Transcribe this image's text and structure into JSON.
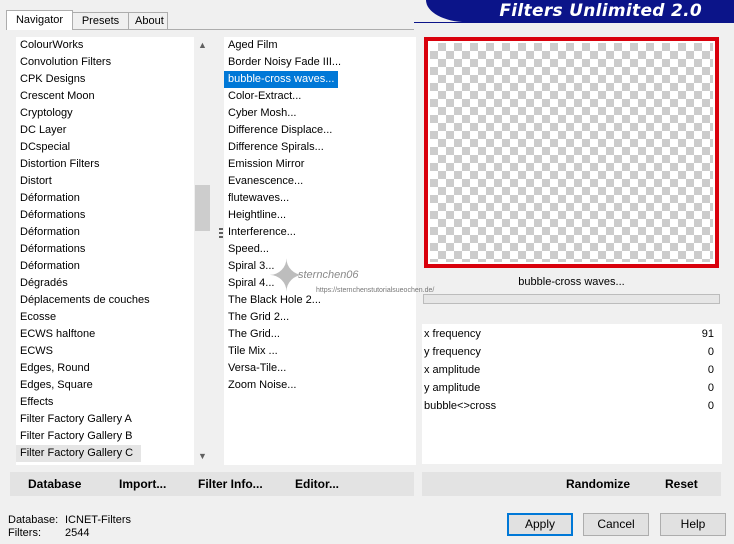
{
  "window": {
    "banner_title": "Filters Unlimited 2.0"
  },
  "tabs": [
    {
      "label": "Navigator",
      "active": true
    },
    {
      "label": "Presets",
      "active": false
    },
    {
      "label": "About",
      "active": false
    }
  ],
  "categories": {
    "items": [
      "ColourWorks",
      "Convolution Filters",
      "CPK Designs",
      "Crescent Moon",
      "Cryptology",
      "DC Layer",
      "DCspecial",
      "Distortion Filters",
      "Distort",
      "Déformation",
      "Déformations",
      "Déformation",
      "Déformations",
      "Déformation",
      "Dégradés",
      "Déplacements de couches",
      "Ecosse",
      "ECWS halftone",
      "ECWS",
      "Edges, Round",
      "Edges, Square",
      "Effects",
      "Filter Factory Gallery A",
      "Filter Factory Gallery B",
      "Filter Factory Gallery C"
    ],
    "selected": "Filter Factory Gallery C"
  },
  "filters": {
    "items": [
      "Aged Film",
      "Border Noisy Fade III...",
      "bubble-cross waves...",
      "Color-Extract...",
      "Cyber Mosh...",
      "Difference Displace...",
      "Difference Spirals...",
      "Emission Mirror",
      "Evanescence...",
      "flutewaves...",
      "Heightline...",
      "Interference...",
      "Speed...",
      "Spiral 3...",
      "Spiral 4...",
      "The Black Hole 2...",
      "The Grid 2...",
      "The Grid...",
      "Tile Mix ...",
      "Versa-Tile...",
      "Zoom Noise..."
    ],
    "selected": "bubble-cross waves..."
  },
  "preview": {
    "filter_name": "bubble-cross waves...",
    "frame_color": "#d9000c"
  },
  "params": [
    {
      "name": "x frequency",
      "value": "91"
    },
    {
      "name": "y frequency",
      "value": "0"
    },
    {
      "name": "x amplitude",
      "value": "0"
    },
    {
      "name": "y amplitude",
      "value": "0"
    },
    {
      "name": "bubble<>cross",
      "value": "0"
    }
  ],
  "left_buttons": {
    "database": "Database",
    "import": "Import...",
    "filter_info": "Filter Info...",
    "editor": "Editor..."
  },
  "right_buttons": {
    "randomize": "Randomize",
    "reset": "Reset"
  },
  "status": {
    "database_label": "Database:",
    "database_value": "ICNET-Filters",
    "filters_label": "Filters:",
    "filters_value": "2544"
  },
  "dialog_buttons": {
    "apply": "Apply",
    "cancel": "Cancel",
    "help": "Help"
  },
  "watermark": {
    "name": "sternchen06",
    "url": "https://sternchenstutorialsueochen.de/"
  },
  "colors": {
    "banner": "#0b1489",
    "selection": "#0078d7",
    "preview_frame": "#d9000c"
  }
}
